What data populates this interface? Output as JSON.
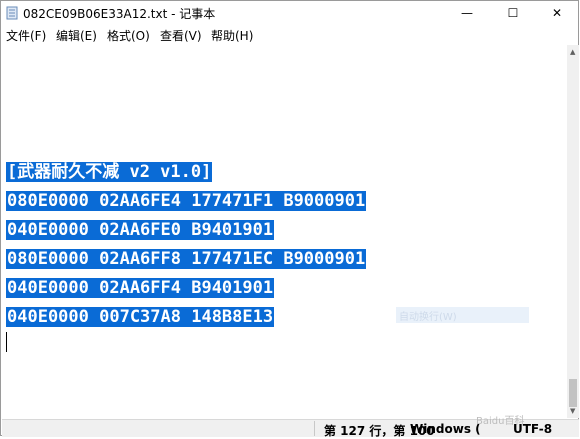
{
  "window": {
    "title": "082CE09B06E33A12.txt - 记事本"
  },
  "controls": {
    "minimize": "—",
    "maximize": "☐",
    "close": "✕"
  },
  "menu": [
    {
      "label": "文件(F)"
    },
    {
      "label": "编辑(E)"
    },
    {
      "label": "格式(O)"
    },
    {
      "label": "查看(V)"
    },
    {
      "label": "帮助(H)"
    }
  ],
  "document": {
    "lines": [
      "[武器耐久不减 v2 v1.0]",
      "080E0000 02AA6FE4 177471F1 B9000901",
      "040E0000 02AA6FE0 B9401901",
      "080E0000 02AA6FF8 177471EC B9000901",
      "040E0000 02AA6FF4 B9401901",
      "040E0000 007C37A8 148B8E13"
    ],
    "ghost_text": "自动换行(W)"
  },
  "status": {
    "position": "第 127 行，第 100",
    "line_ending": "Windows (",
    "encoding": "UTF-8"
  },
  "watermark": "Baidu百科"
}
